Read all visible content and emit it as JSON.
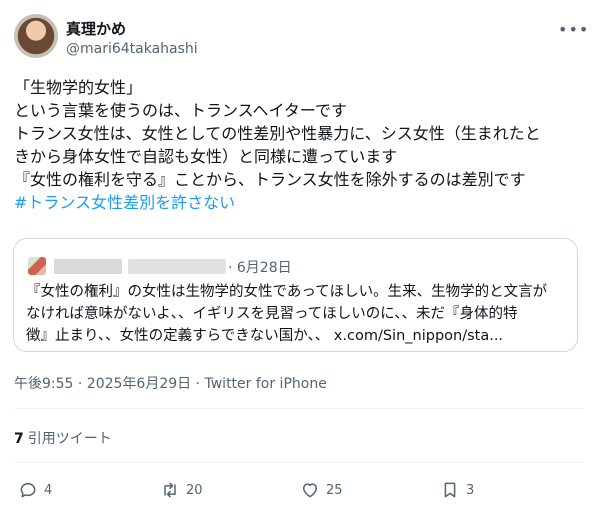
{
  "author": {
    "name": "真理かめ",
    "handle": "@mari64takahashi",
    "more_icon": "more-icon"
  },
  "post": {
    "lines": [
      "「生物学的女性」",
      "という言葉を使うのは、トランスヘイターです",
      "トランス女性は、女性としての性差別や性暴力に、シス女性（生まれたと",
      "きから身体女性で自認も女性）と同様に遭っています",
      "『女性の権利を守る』ことから、トランス女性を除外するのは差別です"
    ],
    "hashtag": "#トランス女性差別を許さない"
  },
  "quoted": {
    "date": "· 6月28日",
    "lines": [
      "『女性の権利』の女性は生物学的女性であってほしい。生来、生物学的と文言が",
      "なければ意味がないよ、、イギリスを見習ってほしいのに、、未だ『身体的特",
      "徴』止まり、、女性の定義すらできない国か、、 x.com/Sin_nippon/sta..."
    ]
  },
  "meta": "午後9:55 · 2025年6月29日 · Twitter for iPhone",
  "quote_stats": {
    "count": "7",
    "label": "引用ツイート"
  },
  "actions": {
    "reply": {
      "icon": "reply-icon",
      "count": "4"
    },
    "retweet": {
      "icon": "retweet-icon",
      "count": "20"
    },
    "like": {
      "icon": "heart-icon",
      "count": "25"
    },
    "bookmark": {
      "icon": "bookmark-icon",
      "count": "3"
    }
  },
  "colors": {
    "accent": "#1d9bf0",
    "secondary": "#536471",
    "border": "#cfd9de"
  }
}
